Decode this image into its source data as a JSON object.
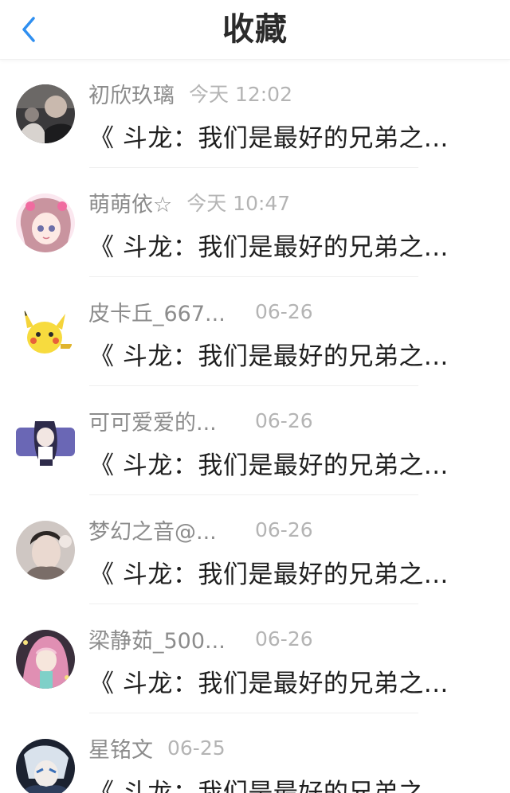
{
  "header": {
    "title": "收藏",
    "back_icon": "chevron-left-icon",
    "accent_color": "#2f8ff0"
  },
  "items": [
    {
      "name": "初欣玖璃",
      "time": "今天 12:02",
      "message": "《 斗龙：我们是最好的兄弟之..."
    },
    {
      "name": "萌萌依☆",
      "time": "今天 10:47",
      "message": "《 斗龙：我们是最好的兄弟之..."
    },
    {
      "name": "皮卡丘_667...",
      "time": "06-26",
      "message": "《 斗龙：我们是最好的兄弟之..."
    },
    {
      "name": "可可爱爱的...",
      "time": "06-26",
      "message": "《 斗龙：我们是最好的兄弟之..."
    },
    {
      "name": "梦幻之音@...",
      "time": "06-26",
      "message": "《 斗龙：我们是最好的兄弟之..."
    },
    {
      "name": "梁静茹_500...",
      "time": "06-26",
      "message": "《 斗龙：我们是最好的兄弟之..."
    },
    {
      "name": "星铭文",
      "time": "06-25",
      "message": "《 斗龙：我们是最好的兄弟之..."
    }
  ]
}
